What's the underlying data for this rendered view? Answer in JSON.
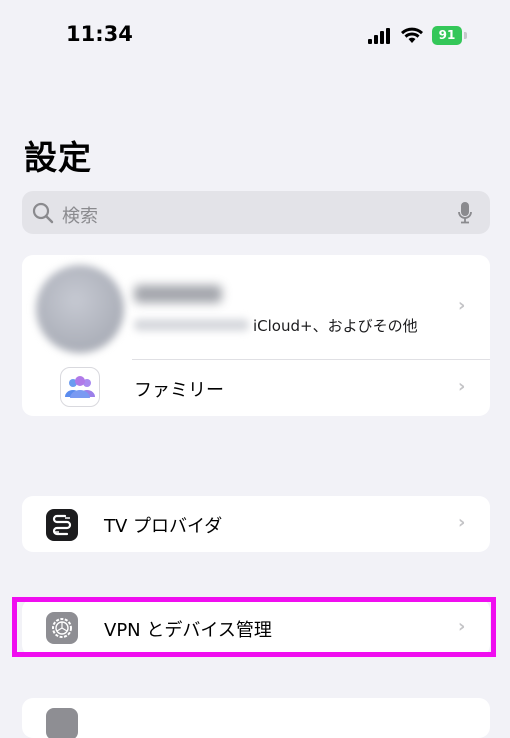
{
  "status_bar": {
    "time": "11:34",
    "battery": "91",
    "battery_color": "#34c759",
    "icons": [
      "signal-icon",
      "wifi-icon",
      "battery-icon"
    ]
  },
  "page": {
    "title": "設定"
  },
  "search": {
    "placeholder": "検索",
    "icons": [
      "search-icon",
      "microphone-icon"
    ]
  },
  "account": {
    "subtitle": "iCloud+、およびその他"
  },
  "rows": {
    "family": {
      "label": "ファミリー",
      "icon": "family-icon"
    },
    "tv_provider": {
      "label": "TV プロバイダ",
      "icon": "tv-provider-icon"
    },
    "vpn": {
      "label": "VPN とデバイス管理",
      "icon": "gear-icon"
    }
  },
  "colors": {
    "highlight": "#f00ef0"
  }
}
